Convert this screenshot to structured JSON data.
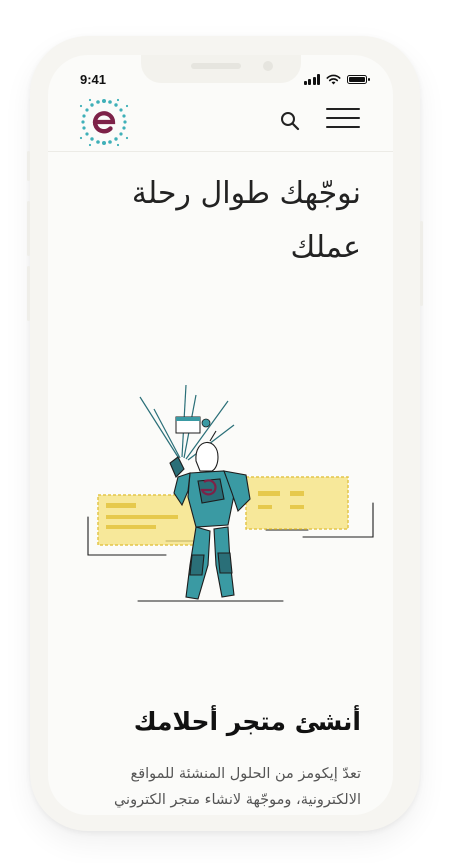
{
  "status_bar": {
    "time": "9:41"
  },
  "header": {
    "logo_letter": "e",
    "icons": {
      "search": "search-icon",
      "menu": "hamburger-menu-icon"
    }
  },
  "hero": {
    "title_line1": "نوجّهك طوال رحلة",
    "title_line2": "عملك"
  },
  "illustration": {
    "logo_letter": "e",
    "colors": {
      "teal": "#3a9aa3",
      "teal_dark": "#2a6f78",
      "yellow": "#f5e27a",
      "ink": "#1d1d1d"
    }
  },
  "section": {
    "title": "أنشئ متجر أحلامك",
    "body_line1": "تعدّ إيكومز من الحلول المنشئة للمواقع",
    "body_line2": "الالكترونية، وموجّهة لانشاء متجر الكتروني"
  },
  "colors": {
    "brand_teal": "#3fb0b8",
    "brand_maroon": "#7d2248",
    "screen_bg": "#fbfbf9"
  }
}
